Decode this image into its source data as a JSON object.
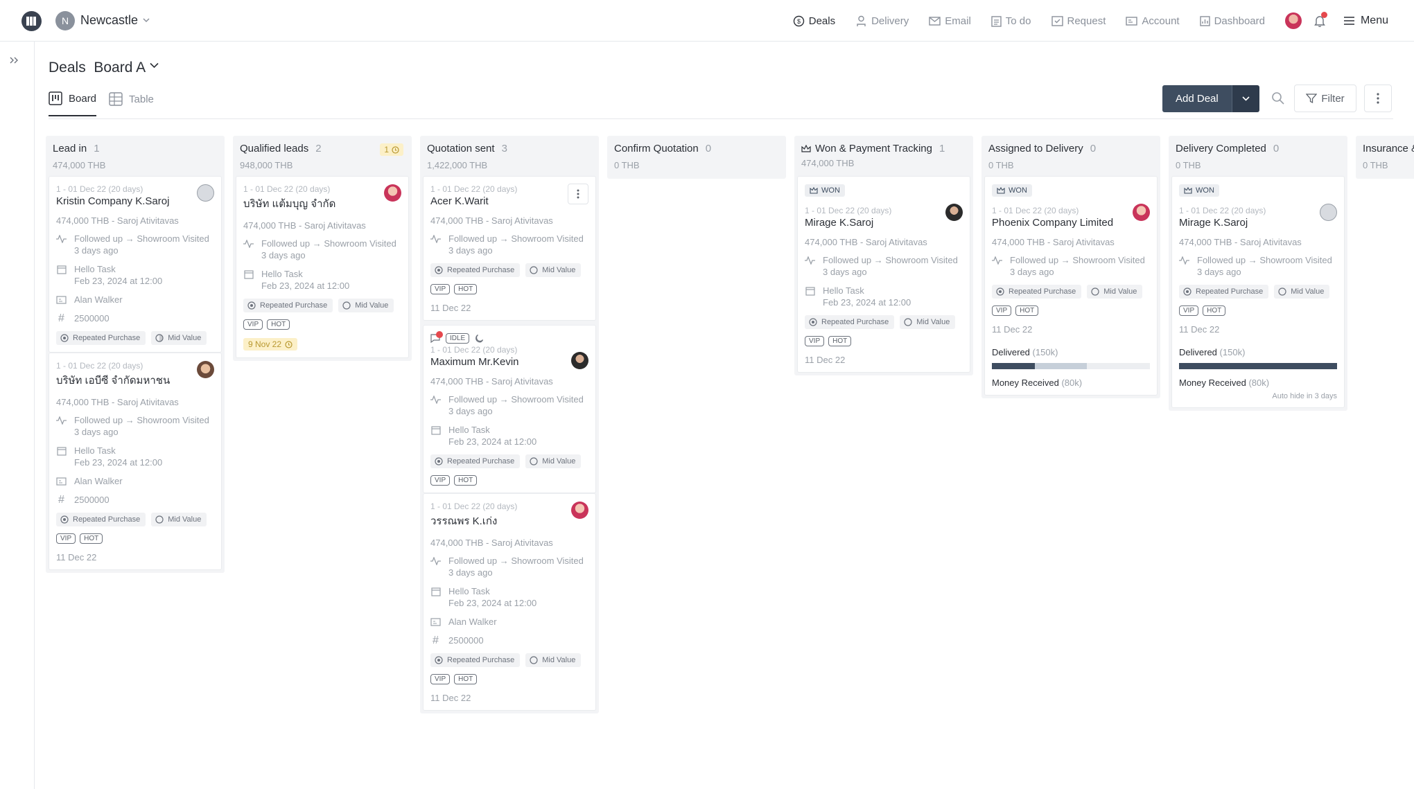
{
  "header": {
    "workspace_initial": "N",
    "workspace_name": "Newcastle",
    "nav": [
      {
        "label": "Deals",
        "icon": "deals-icon",
        "active": true
      },
      {
        "label": "Delivery",
        "icon": "delivery-icon"
      },
      {
        "label": "Email",
        "icon": "email-icon"
      },
      {
        "label": "To do",
        "icon": "todo-icon"
      },
      {
        "label": "Request",
        "icon": "request-icon"
      },
      {
        "label": "Account",
        "icon": "account-icon"
      },
      {
        "label": "Dashboard",
        "icon": "dashboard-icon"
      }
    ],
    "notification_count": "1",
    "menu_label": "Menu"
  },
  "page": {
    "title": "Deals  Board A",
    "views": {
      "board": "Board",
      "table": "Table"
    },
    "add_deal": "Add Deal",
    "filter": "Filter"
  },
  "columns": [
    {
      "title": "Lead in",
      "count": "1",
      "total": "474,000 THB"
    },
    {
      "title": "Qualified leads",
      "count": "2",
      "total": "948,000 THB",
      "badge": "1"
    },
    {
      "title": "Quotation sent",
      "count": "3",
      "total": "1,422,000 THB"
    },
    {
      "title": "Confirm Quotation",
      "count": "0",
      "total": "0 THB"
    },
    {
      "title": "Won & Payment Tracking",
      "count": "1",
      "total": "474,000 THB"
    },
    {
      "title": "Assigned to Delivery",
      "count": "0",
      "total": "0 THB"
    },
    {
      "title": "Delivery Completed",
      "count": "0",
      "total": "0 THB"
    },
    {
      "title": "Insurance &",
      "total": "0 THB"
    }
  ],
  "common": {
    "date_range": "1 - 01 Dec 22 (20 days)",
    "amount_owner": "474,000 THB  - Saroj Ativitavas",
    "activity": "Followed up → Showroom Visited",
    "activity_time": "3 days ago",
    "task_title": "Hello Task",
    "task_date": "Feb 23, 2024 at 12:00",
    "contact": "Alan Walker",
    "number": "2500000",
    "tag_repeat": "Repeated Purchase",
    "tag_mid": "Mid Value",
    "pill_vip": "VIP",
    "pill_hot": "HOT",
    "close_date": "11 Dec 22",
    "won": "WON",
    "idle": "IDLE"
  },
  "cards": {
    "lead1": "Kristin Company K.Saroj",
    "lead2": "บริษัท เอบีซี จำกัดมหาชน",
    "qual1": "บริษัท แต้มบุญ จำกัด",
    "qual1_due": "9 Nov 22",
    "quote1": "Acer K.Warit",
    "quote2": "Maximum Mr.Kevin",
    "quote3": "วรรณพร K.เก่ง",
    "won1": "Mirage K.Saroj",
    "assign1": "Phoenix Company Limited",
    "done1": "Mirage K.Saroj"
  },
  "progress": {
    "delivered_label": "Delivered",
    "delivered_value": "(150k)",
    "money_label": "Money Received",
    "money_value": "(80k)",
    "assign_delivered_pct": 60,
    "assign_money_pct": 27,
    "done_delivered_pct": 100,
    "done_money_pct": 100,
    "auto_hide": "Auto hide in 3 days"
  }
}
